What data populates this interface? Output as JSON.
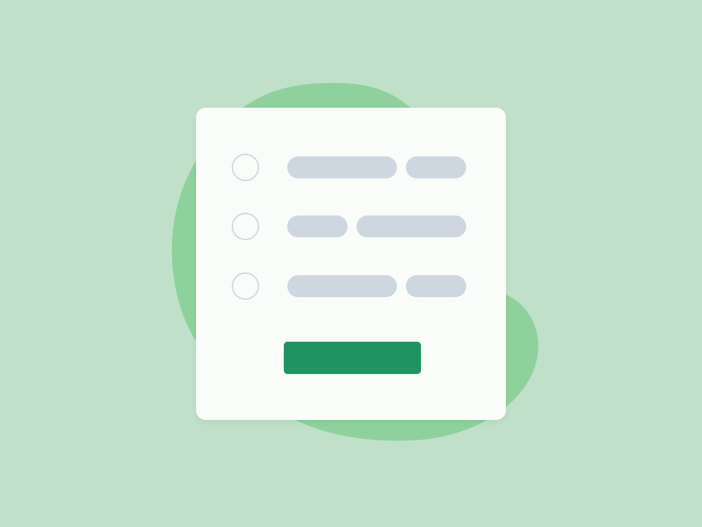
{
  "colors": {
    "background": "#c1e0c9",
    "blob": "#8ed19c",
    "card": "#f9fcf9",
    "placeholder": "#ced6df",
    "radio_border": "#cfd6df",
    "submit": "#1e9560"
  },
  "form": {
    "options": [
      {
        "selected": false
      },
      {
        "selected": false
      },
      {
        "selected": false
      }
    ],
    "submit_label": ""
  }
}
